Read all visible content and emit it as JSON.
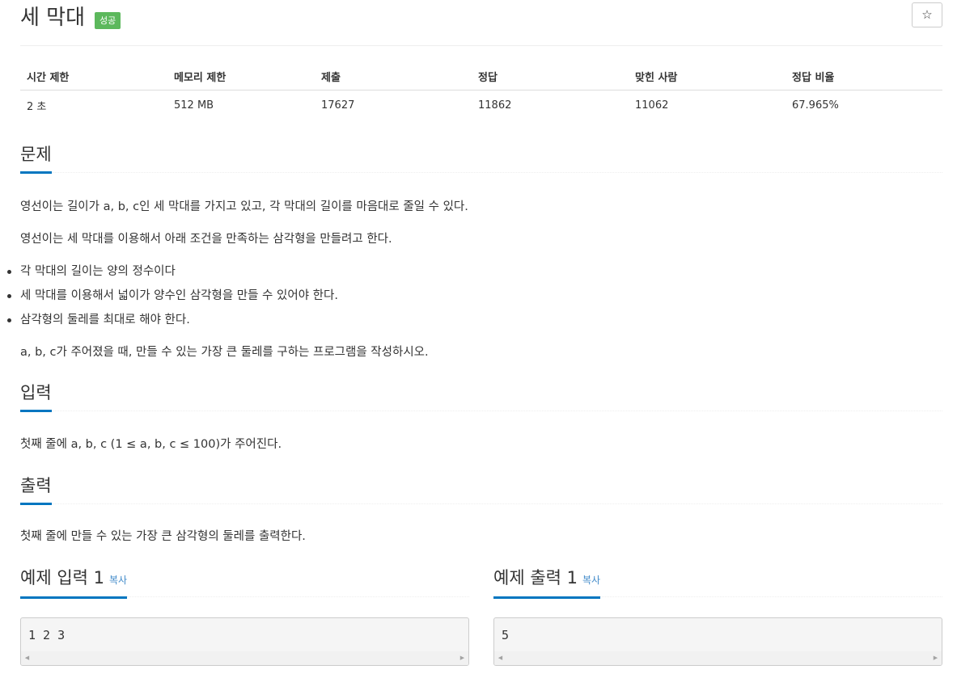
{
  "problem": {
    "title": "세 막대",
    "status_badge": "성공",
    "star_icon": "☆"
  },
  "info_table": {
    "headers": [
      "시간 제한",
      "메모리 제한",
      "제출",
      "정답",
      "맞힌 사람",
      "정답 비율"
    ],
    "values": [
      "2 초",
      "512 MB",
      "17627",
      "11862",
      "11062",
      "67.965%"
    ]
  },
  "description": {
    "heading": "문제",
    "paragraphs": [
      "영선이는 길이가 a, b, c인 세 막대를 가지고 있고, 각 막대의 길이를 마음대로 줄일 수 있다.",
      "영선이는 세 막대를 이용해서 아래 조건을 만족하는 삼각형을 만들려고 한다."
    ],
    "bullets": [
      "각 막대의 길이는 양의 정수이다",
      "세 막대를 이용해서 넓이가 양수인 삼각형을 만들 수 있어야 한다.",
      "삼각형의 둘레를 최대로 해야 한다."
    ],
    "closing": "a, b, c가 주어졌을 때, 만들 수 있는 가장 큰 둘레를 구하는 프로그램을 작성하시오."
  },
  "input": {
    "heading": "입력",
    "text": "첫째 줄에 a, b, c (1 ≤ a, b, c ≤ 100)가 주어진다."
  },
  "output": {
    "heading": "출력",
    "text": "첫째 줄에 만들 수 있는 가장 큰 삼각형의 둘레를 출력한다."
  },
  "samples": {
    "input_heading": "예제 입력 1",
    "output_heading": "예제 출력 1",
    "copy_label": "복사",
    "input_text": "1 2 3",
    "output_text": "5",
    "scroll_left": "◀",
    "scroll_right": "▶"
  }
}
